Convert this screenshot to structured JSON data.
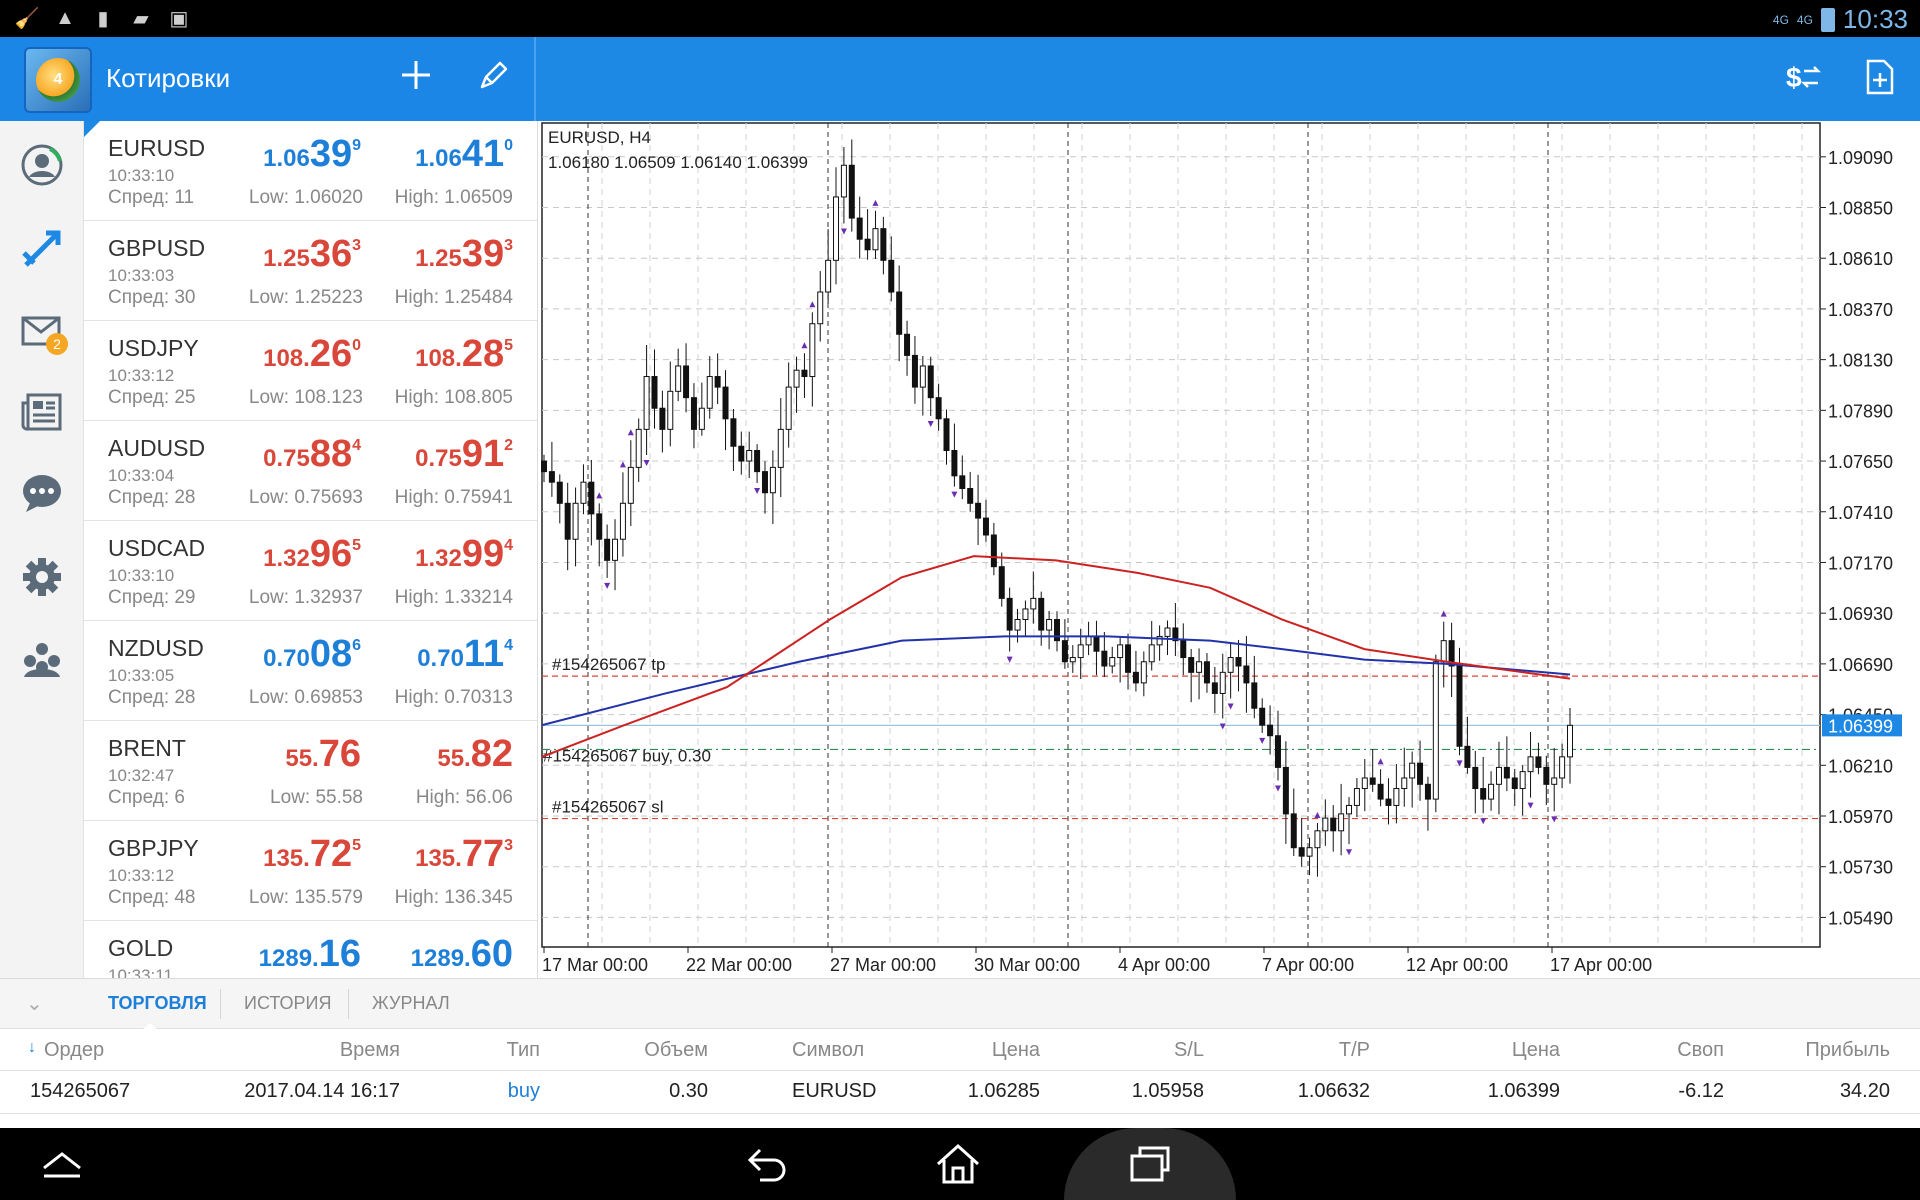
{
  "status_bar": {
    "time": "10:33",
    "net1": "4G",
    "net2": "4G"
  },
  "app_bar": {
    "title": "Котировки",
    "add_icon": "plus-icon",
    "edit_icon": "pencil-icon",
    "trade_icon": "dollar-swap-icon",
    "new_order_icon": "file-plus-icon"
  },
  "sidebar": {
    "items": [
      {
        "name": "account-icon"
      },
      {
        "name": "trade-icon"
      },
      {
        "name": "mail-icon",
        "badge": "2"
      },
      {
        "name": "news-icon"
      },
      {
        "name": "chat-icon"
      },
      {
        "name": "settings-icon"
      },
      {
        "name": "community-icon"
      }
    ]
  },
  "quotes": [
    {
      "symbol": "EURUSD",
      "time": "10:33:10",
      "spread": "Спред: 11",
      "bid": [
        "1.06",
        "39",
        "9"
      ],
      "ask": [
        "1.06",
        "41",
        "0"
      ],
      "low": "Low: 1.06020",
      "high": "High: 1.06509",
      "color": "blue"
    },
    {
      "symbol": "GBPUSD",
      "time": "10:33:03",
      "spread": "Спред: 30",
      "bid": [
        "1.25",
        "36",
        "3"
      ],
      "ask": [
        "1.25",
        "39",
        "3"
      ],
      "low": "Low: 1.25223",
      "high": "High: 1.25484",
      "color": "red"
    },
    {
      "symbol": "USDJPY",
      "time": "10:33:12",
      "spread": "Спред: 25",
      "bid": [
        "108.",
        "26",
        "0"
      ],
      "ask": [
        "108.",
        "28",
        "5"
      ],
      "low": "Low: 108.123",
      "high": "High: 108.805",
      "color": "red"
    },
    {
      "symbol": "AUDUSD",
      "time": "10:33:04",
      "spread": "Спред: 28",
      "bid": [
        "0.75",
        "88",
        "4"
      ],
      "ask": [
        "0.75",
        "91",
        "2"
      ],
      "low": "Low: 0.75693",
      "high": "High: 0.75941",
      "color": "red"
    },
    {
      "symbol": "USDCAD",
      "time": "10:33:10",
      "spread": "Спред: 29",
      "bid": [
        "1.32",
        "96",
        "5"
      ],
      "ask": [
        "1.32",
        "99",
        "4"
      ],
      "low": "Low: 1.32937",
      "high": "High: 1.33214",
      "color": "red"
    },
    {
      "symbol": "NZDUSD",
      "time": "10:33:05",
      "spread": "Спред: 28",
      "bid": [
        "0.70",
        "08",
        "6"
      ],
      "ask": [
        "0.70",
        "11",
        "4"
      ],
      "low": "Low: 0.69853",
      "high": "High: 0.70313",
      "color": "blue"
    },
    {
      "symbol": "BRENT",
      "time": "10:32:47",
      "spread": "Спред: 6",
      "bid": [
        "55.",
        "76",
        ""
      ],
      "ask": [
        "55.",
        "82",
        ""
      ],
      "low": "Low: 55.58",
      "high": "High: 56.06",
      "color": "red"
    },
    {
      "symbol": "GBPJPY",
      "time": "10:33:12",
      "spread": "Спред: 48",
      "bid": [
        "135.",
        "72",
        "5"
      ],
      "ask": [
        "135.",
        "77",
        "3"
      ],
      "low": "Low: 135.579",
      "high": "High: 136.345",
      "color": "red"
    },
    {
      "symbol": "GOLD",
      "time": "10:33:11",
      "spread": "",
      "bid": [
        "1289.",
        "16",
        ""
      ],
      "ask": [
        "1289.",
        "60",
        ""
      ],
      "low": "",
      "high": "",
      "color": "blue"
    }
  ],
  "chart_data": {
    "type": "candlestick",
    "title": "EURUSD, H4",
    "ohlc_label": "1.06180 1.06509 1.06140 1.06399",
    "y_ticks": [
      "1.09090",
      "1.08850",
      "1.08610",
      "1.08370",
      "1.08130",
      "1.07890",
      "1.07650",
      "1.07410",
      "1.07170",
      "1.06930",
      "1.06690",
      "1.06450",
      "1.06210",
      "1.05970",
      "1.05730",
      "1.05490"
    ],
    "ylim": [
      1.0535,
      1.0925
    ],
    "x_labels": [
      "17 Mar 00:00",
      "22 Mar 00:00",
      "27 Mar 00:00",
      "30 Mar 00:00",
      "4 Apr 00:00",
      "7 Apr 00:00",
      "12 Apr 00:00",
      "17 Apr 00:00"
    ],
    "current_price": "1.06399",
    "current_value": 1.06399,
    "order_lines": [
      {
        "label": "#154265067 tp",
        "value": 1.06632,
        "color": "#d9473a",
        "style": "dash"
      },
      {
        "label": "#154265067 buy, 0.30",
        "value": 1.06285,
        "color": "#2e8b57",
        "style": "dashdot"
      },
      {
        "label": "#154265067 sl",
        "value": 1.05958,
        "color": "#d9473a",
        "style": "dash"
      }
    ],
    "closes": [
      1.076,
      1.0755,
      1.0745,
      1.0728,
      1.0745,
      1.0755,
      1.074,
      1.0728,
      1.0718,
      1.0728,
      1.0745,
      1.0762,
      1.078,
      1.0805,
      1.079,
      1.078,
      1.0798,
      1.081,
      1.0795,
      1.078,
      1.079,
      1.0805,
      1.08,
      1.0785,
      1.0772,
      1.0765,
      1.077,
      1.076,
      1.075,
      1.0762,
      1.078,
      1.08,
      1.0808,
      1.0805,
      1.083,
      1.0845,
      1.086,
      1.089,
      1.0905,
      1.088,
      1.087,
      1.0865,
      1.0875,
      1.086,
      1.0845,
      1.0825,
      1.0815,
      1.08,
      1.081,
      1.0795,
      1.0785,
      1.077,
      1.0758,
      1.0752,
      1.0745,
      1.0738,
      1.073,
      1.0715,
      1.07,
      1.0685,
      1.069,
      1.0695,
      1.07,
      1.0685,
      1.069,
      1.068,
      1.067,
      1.0672,
      1.0678,
      1.0682,
      1.0675,
      1.0668,
      1.0672,
      1.0678,
      1.0665,
      1.066,
      1.067,
      1.0678,
      1.0682,
      1.0686,
      1.068,
      1.0672,
      1.0665,
      1.067,
      1.066,
      1.0655,
      1.0665,
      1.0672,
      1.0668,
      1.066,
      1.0648,
      1.064,
      1.0635,
      1.062,
      1.0598,
      1.0582,
      1.0578,
      1.0582,
      1.059,
      1.0596,
      1.059,
      1.0598,
      1.0602,
      1.061,
      1.0615,
      1.0612,
      1.0605,
      1.0602,
      1.061,
      1.0615,
      1.0622,
      1.0612,
      1.0605,
      1.067,
      1.068,
      1.0668,
      1.063,
      1.062,
      1.061,
      1.0605,
      1.0612,
      1.062,
      1.0615,
      1.061,
      1.0618,
      1.0625,
      1.062,
      1.0612,
      1.0615,
      1.0625,
      1.06399
    ],
    "ma_slow": [
      [
        0,
        1.064
      ],
      [
        0.12,
        1.0655
      ],
      [
        0.25,
        1.067
      ],
      [
        0.35,
        1.068
      ],
      [
        0.45,
        1.0682
      ],
      [
        0.55,
        1.0682
      ],
      [
        0.65,
        1.068
      ],
      [
        0.72,
        1.0676
      ],
      [
        0.8,
        1.0671
      ],
      [
        0.88,
        1.0669
      ],
      [
        1,
        1.0664
      ]
    ],
    "ma_fast": [
      [
        0,
        1.0625
      ],
      [
        0.08,
        1.064
      ],
      [
        0.18,
        1.0658
      ],
      [
        0.28,
        1.069
      ],
      [
        0.35,
        1.071
      ],
      [
        0.42,
        1.072
      ],
      [
        0.5,
        1.0718
      ],
      [
        0.58,
        1.0712
      ],
      [
        0.65,
        1.0705
      ],
      [
        0.72,
        1.069
      ],
      [
        0.8,
        1.0676
      ],
      [
        0.88,
        1.067
      ],
      [
        1,
        1.0662
      ]
    ]
  },
  "bottom_panel": {
    "tabs": [
      "ТОРГОВЛЯ",
      "ИСТОРИЯ",
      "ЖУРНАЛ"
    ],
    "headers": [
      "Ордер",
      "Время",
      "Тип",
      "Объем",
      "Символ",
      "Цена",
      "S/L",
      "T/P",
      "Цена",
      "Своп",
      "Прибыль"
    ],
    "row": [
      "154265067",
      "2017.04.14 16:17",
      "buy",
      "0.30",
      "EURUSD",
      "1.06285",
      "1.05958",
      "1.06632",
      "1.06399",
      "-6.12",
      "34.20"
    ]
  },
  "nav_bar": {
    "icons": [
      "home-up-icon",
      "back-icon",
      "home-icon",
      "recents-icon"
    ]
  },
  "colors": {
    "accent": "#1e88e5",
    "bid_blue": "#1e7fd8",
    "bid_red": "#d9473a",
    "ma_red": "#cc2222",
    "ma_blue": "#2233aa"
  }
}
